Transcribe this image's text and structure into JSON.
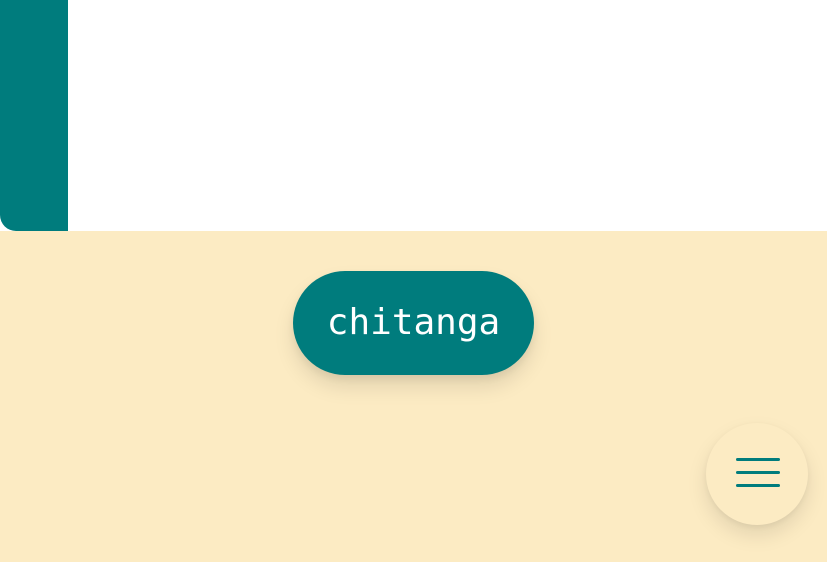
{
  "main": {
    "primary_button_label": "chitanga"
  },
  "menu": {
    "icon": "hamburger-menu-icon"
  },
  "colors": {
    "accent": "#007c7d",
    "background": "#fcebc3",
    "panel": "#ffffff"
  }
}
